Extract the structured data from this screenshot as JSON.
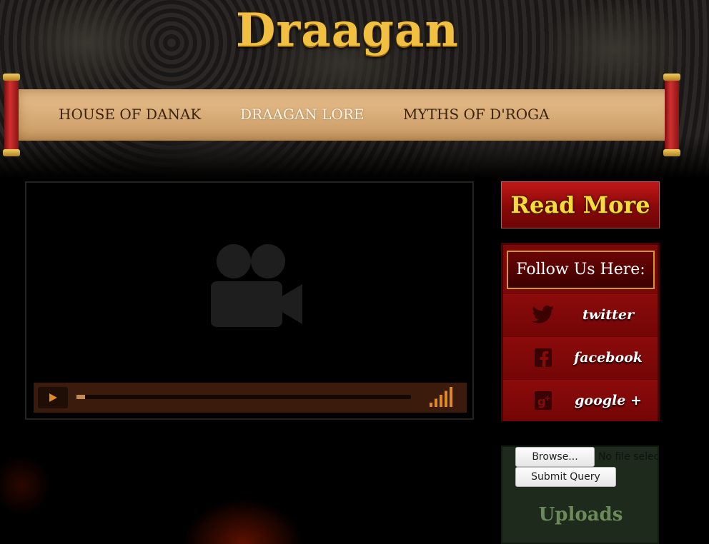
{
  "site": {
    "logo_text": "Draagan"
  },
  "nav": {
    "items": [
      {
        "label": "HOUSE OF DANAK",
        "active": false
      },
      {
        "label": "DRAAGAN LORE",
        "active": true
      },
      {
        "label": "MYTHS OF D'ROGA",
        "active": false
      }
    ]
  },
  "video": {
    "progress": 0.02,
    "volume_bars": 5,
    "volume_level": 5
  },
  "sidebar": {
    "read_more_label": "Read More",
    "follow": {
      "title": "Follow Us Here:",
      "links": [
        {
          "label": "twitter",
          "icon": "twitter-icon"
        },
        {
          "label": "facebook",
          "icon": "facebook-icon"
        },
        {
          "label": "google +",
          "icon": "google-plus-icon"
        }
      ]
    },
    "uploads": {
      "browse_label": "Browse...",
      "no_file_text": "No file selected.",
      "submit_label": "Submit Query",
      "title": "Uploads"
    }
  },
  "colors": {
    "scroll": "#d9ad78",
    "red_panel": "#7b0707",
    "gold": "#f2c040",
    "player_bar": "#3b1c0c",
    "accent_orange": "#e08a20"
  }
}
